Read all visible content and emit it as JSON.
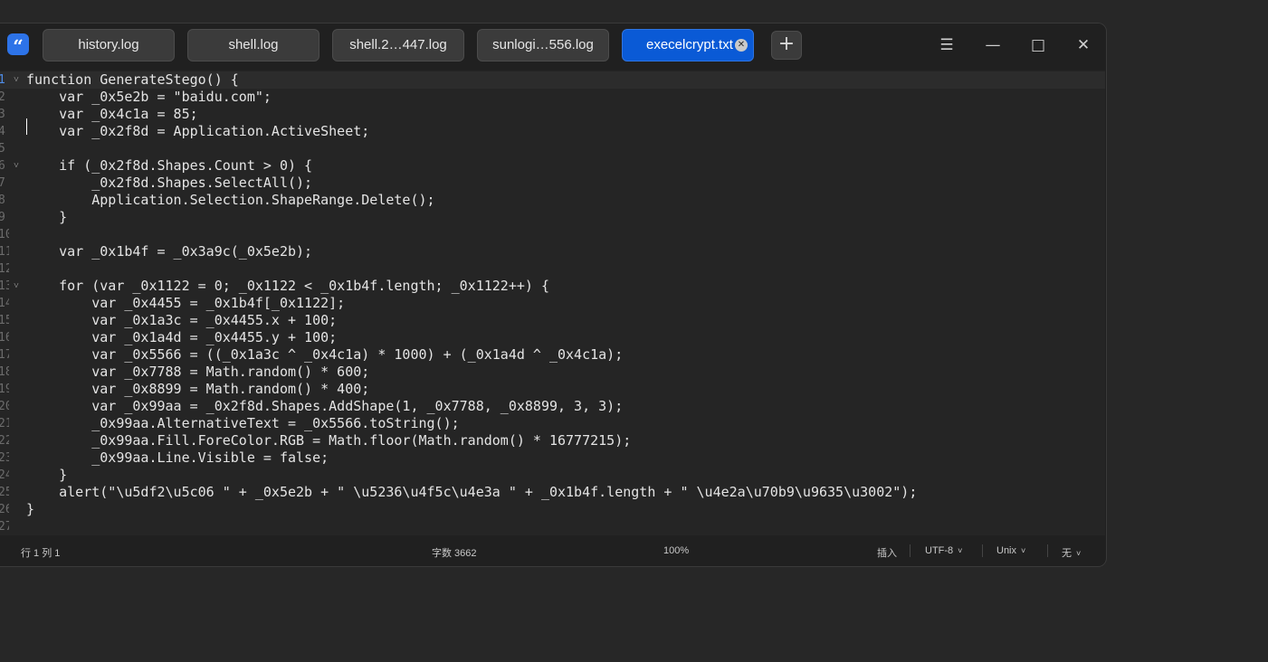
{
  "app": {
    "icon_glyph": "“"
  },
  "tabs": [
    {
      "label": "history.log",
      "active": false
    },
    {
      "label": "shell.log",
      "active": false
    },
    {
      "label": "shell.2…447.log",
      "active": false
    },
    {
      "label": "sunlogi…556.log",
      "active": false
    },
    {
      "label": "execelcrypt.txt",
      "active": true
    }
  ],
  "new_tab_glyph": "+",
  "window_controls": {
    "menu": "☰",
    "minimize": "—",
    "maximize": "□",
    "close": "✕"
  },
  "editor": {
    "lines": [
      "function GenerateStego() {",
      "    var _0x5e2b = \"baidu.com\";",
      "    var _0x4c1a = 85;",
      "    var _0x2f8d = Application.ActiveSheet;",
      "",
      "    if (_0x2f8d.Shapes.Count > 0) {",
      "        _0x2f8d.Shapes.SelectAll();",
      "        Application.Selection.ShapeRange.Delete();",
      "    }",
      "",
      "    var _0x1b4f = _0x3a9c(_0x5e2b);",
      "",
      "    for (var _0x1122 = 0; _0x1122 < _0x1b4f.length; _0x1122++) {",
      "        var _0x4455 = _0x1b4f[_0x1122];",
      "        var _0x1a3c = _0x4455.x + 100;",
      "        var _0x1a4d = _0x4455.y + 100;",
      "        var _0x5566 = ((_0x1a3c ^ _0x4c1a) * 1000) + (_0x1a4d ^ _0x4c1a);",
      "        var _0x7788 = Math.random() * 600;",
      "        var _0x8899 = Math.random() * 400;",
      "        var _0x99aa = _0x2f8d.Shapes.AddShape(1, _0x7788, _0x8899, 3, 3);",
      "        _0x99aa.AlternativeText = _0x5566.toString();",
      "        _0x99aa.Fill.ForeColor.RGB = Math.floor(Math.random() * 16777215);",
      "        _0x99aa.Line.Visible = false;",
      "    }",
      "    alert(\"\\u5df2\\u5c06 \" + _0x5e2b + \" \\u5236\\u4f5c\\u4e3a \" + _0x1b4f.length + \" \\u4e2a\\u70b9\\u9635\\u3002\");",
      "}",
      ""
    ],
    "line_numbers": [
      "1",
      "2",
      "3",
      "4",
      "5",
      "6",
      "7",
      "8",
      "9",
      "10",
      "11",
      "12",
      "13",
      "14",
      "15",
      "16",
      "17",
      "18",
      "19",
      "20",
      "21",
      "22",
      "23",
      "24",
      "25",
      "26",
      "27"
    ],
    "fold_lines": [
      1,
      6,
      13
    ],
    "fold_glyph": "˅"
  },
  "status": {
    "position": "行 1 列 1",
    "char_count": "字数 3662",
    "zoom": "100%",
    "mode": "插入",
    "encoding": "UTF-8",
    "line_ending": "Unix",
    "syntax": "无",
    "chevron": "˅"
  }
}
